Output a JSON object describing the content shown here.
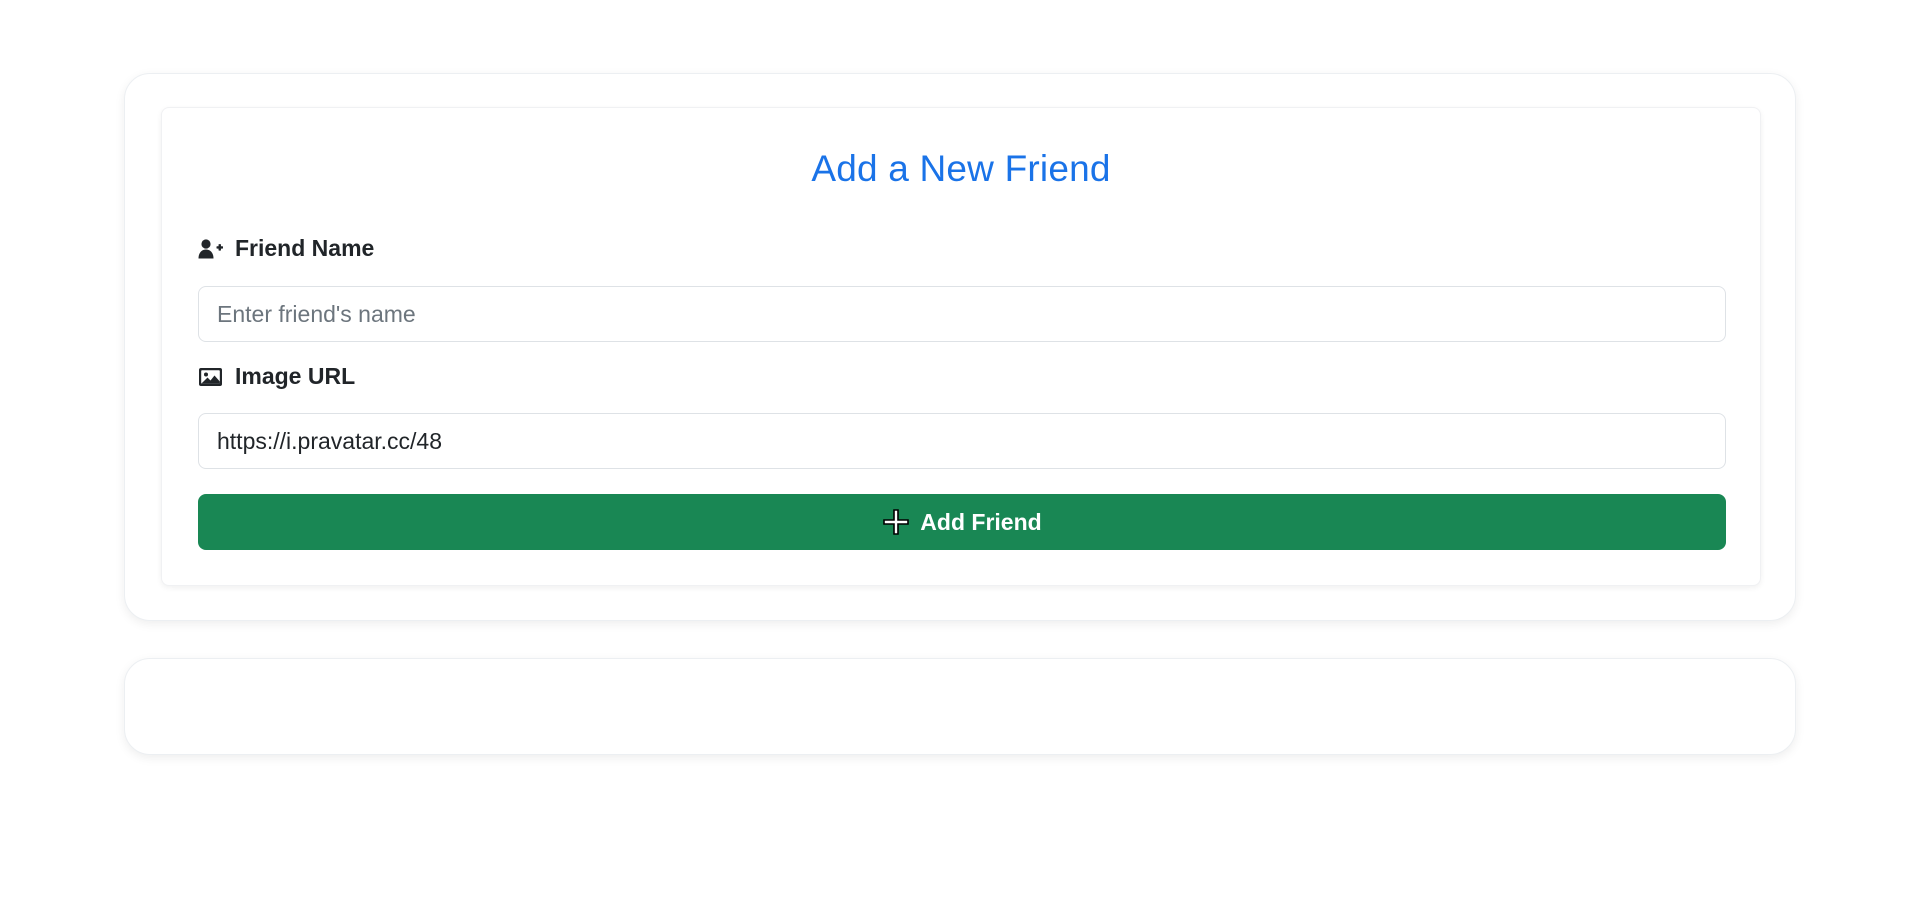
{
  "form": {
    "title": "Add a New Friend",
    "name_field": {
      "label": "Friend Name",
      "icon": "user-plus-icon",
      "placeholder": "Enter friend's name",
      "value": ""
    },
    "url_field": {
      "label": "Image URL",
      "icon": "image-icon",
      "placeholder": "",
      "value": "https://i.pravatar.cc/48"
    },
    "submit": {
      "label": "Add Friend",
      "icon": "plus-icon"
    }
  },
  "friends_list": {
    "items": []
  },
  "colors": {
    "title": "#1a73e8",
    "button": "#198754",
    "button_text": "#ffffff",
    "text": "#212529"
  }
}
